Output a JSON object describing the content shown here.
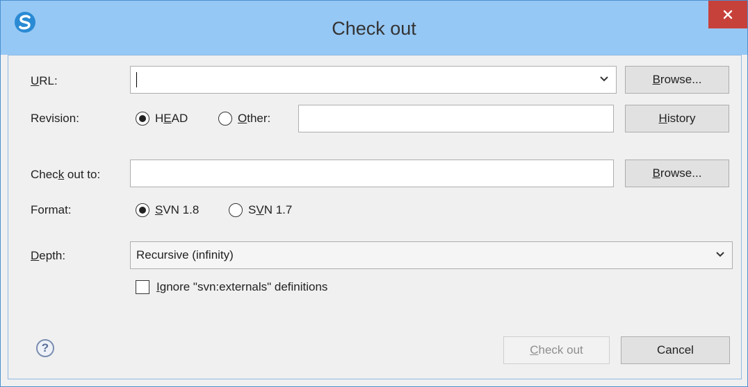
{
  "window": {
    "title": "Check out",
    "close_glyph": "✕"
  },
  "url": {
    "label_u": "U",
    "label_rest": "RL:",
    "value": "",
    "browse_u": "B",
    "browse_rest": "rowse..."
  },
  "revision": {
    "label": "Revision:",
    "head_pre": "H",
    "head_u": "E",
    "head_post": "AD",
    "head_selected": true,
    "other_u": "O",
    "other_rest": "ther:",
    "other_value": "",
    "history_u": "H",
    "history_rest": "istory"
  },
  "checkout_to": {
    "label_pre": "Chec",
    "label_u": "k",
    "label_post": " out to:",
    "value": "",
    "browse_u": "B",
    "browse_rest": "rowse..."
  },
  "format": {
    "label": "Format:",
    "opt1_u": "S",
    "opt1_rest": "VN 1.8",
    "opt1_selected": true,
    "opt2_pre": "S",
    "opt2_u": "V",
    "opt2_post": "N 1.7"
  },
  "depth": {
    "label_u": "D",
    "label_rest": "epth:",
    "value": "Recursive (infinity)"
  },
  "ignore_externals": {
    "label_u": "I",
    "label_rest": "gnore \"svn:externals\" definitions",
    "checked": false
  },
  "footer": {
    "help_glyph": "?",
    "checkout_u": "C",
    "checkout_rest": "heck out",
    "checkout_enabled": false,
    "cancel_label": "Cancel"
  },
  "colors": {
    "titlebar": "#96c8f5",
    "close": "#c7413b",
    "accent": "#2a8ad4"
  }
}
